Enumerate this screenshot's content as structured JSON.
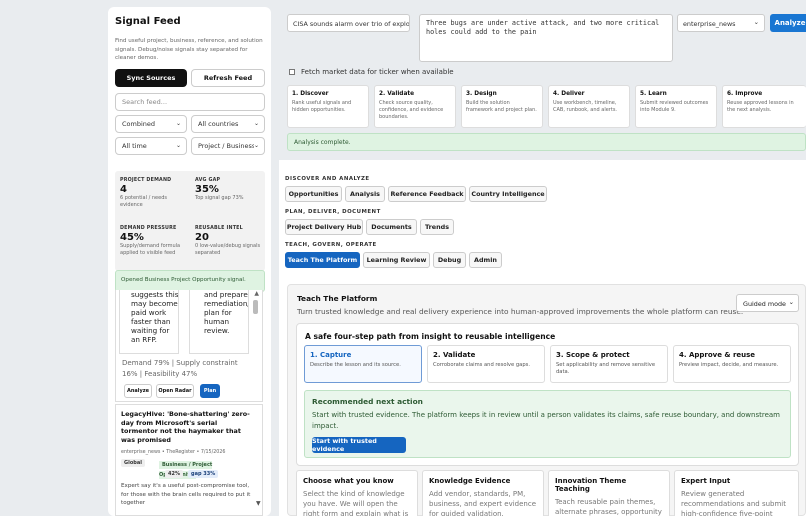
{
  "sidebar": {
    "title": "Signal Feed",
    "description": "Find useful project, business, reference, and solution signals. Debug/noise signals stay separated for cleaner demos.",
    "sync_label": "Sync Sources",
    "refresh_label": "Refresh Feed",
    "search_placeholder": "Search feed...",
    "filter_type": "Combined",
    "filter_country": "All countries",
    "filter_time": "All time",
    "filter_category": "Project / Business",
    "metrics": [
      {
        "label": "PROJECT DEMAND",
        "value": "4",
        "sub": "6 potential / needs evidence"
      },
      {
        "label": "AVG GAP",
        "value": "35%",
        "sub": "Top signal gap 73%"
      },
      {
        "label": "DEMAND PRESSURE",
        "value": "45%",
        "sub": "Supply/demand formula applied to visible feed"
      },
      {
        "label": "REUSABLE INTEL",
        "value": "20",
        "sub": "0 low-value/debug signals separated"
      }
    ],
    "notice": "Opened Business Project Opportunity signal.",
    "card1": {
      "left_text": "suggests this may become paid work faster than waiting for an RFP.",
      "right_text": "and prepare remediation/CAB/runbook plan for human review.",
      "stats": "Demand 79% | Supply constraint 16% | Feasibility 47%",
      "btn_analyze": "Analyze",
      "btn_radar": "Open Radar",
      "btn_plan": "Plan"
    },
    "card2": {
      "title": "LegacyHive: 'Bone-shattering' zero-day from Microsoft's serial tormentor not the haymaker that was promised",
      "meta": "enterprise_news • TheRegister • 7/15/2026",
      "tag_global": "Global",
      "tag_category": "Business / Project Opportunity",
      "tag_pct": "42%",
      "tag_gap": "gap 33%",
      "desc": "Expert say it's a useful post-compromise tool, for those with the brain cells required to put it together"
    }
  },
  "top": {
    "headline_value": "CISA sounds alarm over trio of exploits",
    "summary_value": "Three bugs are under active attack, and two more critical holes could add to the pain",
    "source_value": "enterprise_news",
    "analyze_label": "Analyze",
    "fetch_label": "Fetch market data for ticker when available"
  },
  "steps": [
    {
      "title": "1. Discover",
      "desc": "Rank useful signals and hidden opportunities."
    },
    {
      "title": "2. Validate",
      "desc": "Check source quality, confidence, and evidence boundaries."
    },
    {
      "title": "3. Design",
      "desc": "Build the solution framework and project plan."
    },
    {
      "title": "4. Deliver",
      "desc": "Use workbench, timeline, CAB, runbook, and alerts."
    },
    {
      "title": "5. Learn",
      "desc": "Submit reviewed outcomes into Module 9."
    },
    {
      "title": "6. Improve",
      "desc": "Reuse approved lessons in the next analysis."
    }
  ],
  "analysis_complete": "Analysis complete.",
  "sections": {
    "discover_label": "DISCOVER AND ANALYZE",
    "discover_items": [
      "Opportunities",
      "Analysis",
      "Reference Feedback",
      "Country Intelligence"
    ],
    "plan_label": "PLAN, DELIVER, DOCUMENT",
    "plan_items": [
      "Project Delivery Hub",
      "Documents",
      "Trends"
    ],
    "teach_label": "TEACH, GOVERN, OPERATE",
    "teach_items": [
      "Teach The Platform",
      "Learning Review",
      "Debug",
      "Admin"
    ]
  },
  "teach": {
    "title": "Teach The Platform",
    "desc": "Turn trusted knowledge and real delivery experience into human-approved improvements the whole platform can reuse.",
    "mode": "Guided mode",
    "path_title": "A safe four-step path from insight to reusable intelligence",
    "path_steps": [
      {
        "title": "1. Capture",
        "desc": "Describe the lesson and its source."
      },
      {
        "title": "2. Validate",
        "desc": "Corroborate claims and resolve gaps."
      },
      {
        "title": "3. Scope & protect",
        "desc": "Set applicability and remove sensitive data."
      },
      {
        "title": "4. Approve & reuse",
        "desc": "Preview impact, decide, and measure."
      }
    ],
    "rec_title": "Recommended next action",
    "rec_desc": "Start with trusted evidence. The platform keeps it in review until a person validates its claims, safe reuse boundary, and downstream impact.",
    "rec_button": "Start with trusted evidence",
    "bottom_cards": [
      {
        "title": "Choose what you know",
        "desc": "Select the kind of knowledge you have. We will open the right form and explain what is"
      },
      {
        "title": "Knowledge Evidence",
        "desc": "Add vendor, standards, PM, business, and expert evidence for guided validation."
      },
      {
        "title": "Innovation Theme Teaching",
        "desc": "Teach reusable pain themes, alternate phrases, opportunity patterns and solution"
      },
      {
        "title": "Expert Input",
        "desc": "Review generated recommendations and submit high-confidence five-point"
      }
    ]
  },
  "colors": {
    "accent": "#1565c0",
    "success_bg": "#dff3e2",
    "dark_button": "#111111"
  }
}
